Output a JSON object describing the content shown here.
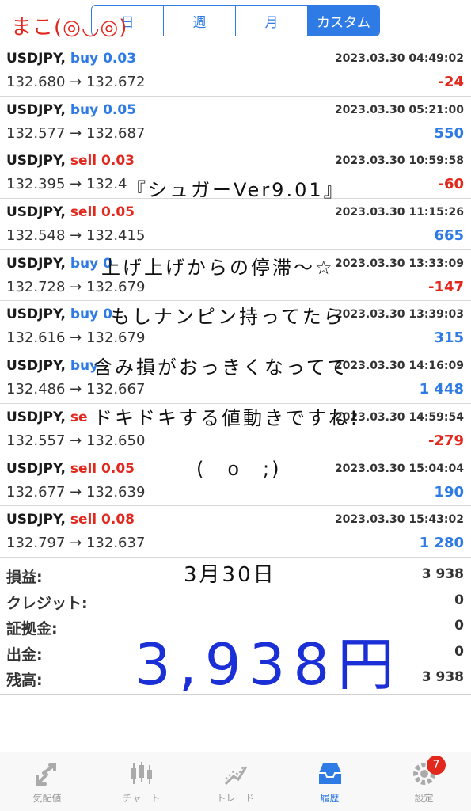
{
  "segments": [
    {
      "label": "日",
      "active": false
    },
    {
      "label": "週",
      "active": false
    },
    {
      "label": "月",
      "active": false
    },
    {
      "label": "カスタム",
      "active": true
    }
  ],
  "handwriting": {
    "author": "まこ(◎◡◎)",
    "title": "『シュガーVer9.01』",
    "line1": "上げ上げからの停滞〜☆",
    "line2": "もしナンピン持ってたら",
    "line3": "含み損がおっきくなってて",
    "line4": "ドキドキする値動きですね!",
    "line5": "(￣o￣;)",
    "date": "3月30日",
    "total": "3,938円"
  },
  "trades": [
    {
      "symbol": "USDJPY,",
      "side": "buy",
      "lot": "buy 0.03",
      "time": "2023.03.30 04:49:02",
      "prices": "132.680 → 132.672",
      "profit": "-24"
    },
    {
      "symbol": "USDJPY,",
      "side": "buy",
      "lot": "buy 0.05",
      "time": "2023.03.30 05:21:00",
      "prices": "132.577 → 132.687",
      "profit": "550"
    },
    {
      "symbol": "USDJPY,",
      "side": "sell",
      "lot": "sell 0.03",
      "time": "2023.03.30 10:59:58",
      "prices": "132.395 → 132.4",
      "profit": "-60"
    },
    {
      "symbol": "USDJPY,",
      "side": "sell",
      "lot": "sell 0.05",
      "time": "2023.03.30 11:15:26",
      "prices": "132.548 → 132.415",
      "profit": "665"
    },
    {
      "symbol": "USDJPY,",
      "side": "buy",
      "lot": "buy 0",
      "time": "2023.03.30 13:33:09",
      "prices": "132.728 → 132.679",
      "profit": "-147"
    },
    {
      "symbol": "USDJPY,",
      "side": "buy",
      "lot": "buy 0",
      "time": "2023.03.30 13:39:03",
      "prices": "132.616 → 132.679",
      "profit": "315"
    },
    {
      "symbol": "USDJPY,",
      "side": "buy",
      "lot": "buy",
      "time": "2023.03.30 14:16:09",
      "prices": "132.486 → 132.667",
      "profit": "1 448"
    },
    {
      "symbol": "USDJPY,",
      "side": "sell",
      "lot": "se",
      "time": "2023.03.30 14:59:54",
      "prices": "132.557 → 132.650",
      "profit": "-279"
    },
    {
      "symbol": "USDJPY,",
      "side": "sell",
      "lot": "sell 0.05",
      "time": "2023.03.30 15:04:04",
      "prices": "132.677 → 132.639",
      "profit": "190"
    },
    {
      "symbol": "USDJPY,",
      "side": "sell",
      "lot": "sell 0.08",
      "time": "2023.03.30 15:43:02",
      "prices": "132.797 → 132.637",
      "profit": "1 280"
    }
  ],
  "summary": [
    {
      "label": "損益:",
      "value": "3 938"
    },
    {
      "label": "クレジット:",
      "value": "0"
    },
    {
      "label": "証拠金:",
      "value": "0"
    },
    {
      "label": "出金:",
      "value": "0"
    },
    {
      "label": "残高:",
      "value": "3 938"
    }
  ],
  "tabs": [
    {
      "label": "気配値",
      "icon": "quotes-icon",
      "active": false
    },
    {
      "label": "チャート",
      "icon": "chart-icon",
      "active": false
    },
    {
      "label": "トレード",
      "icon": "trade-icon",
      "active": false
    },
    {
      "label": "履歴",
      "icon": "history-icon",
      "active": true
    },
    {
      "label": "設定",
      "icon": "settings-icon",
      "active": false,
      "badge": "7"
    }
  ],
  "colors": {
    "accent": "#2f7be5",
    "loss": "#e2271d",
    "handwriting_total": "#1a2fd6"
  }
}
